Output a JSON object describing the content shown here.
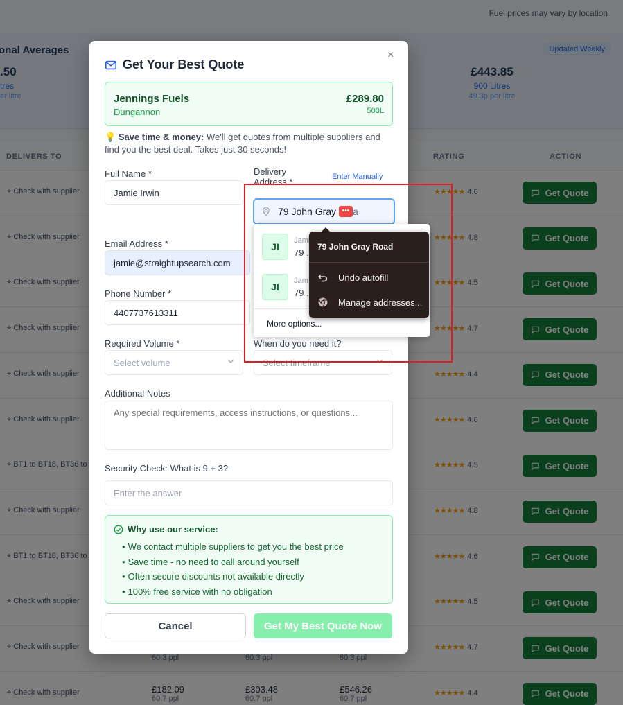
{
  "background": {
    "top_note": "Fuel prices may vary by location",
    "averages_title": "onal Averages",
    "updated_badge": "Updated Weekly",
    "left_price": ".50",
    "left_litres": "tres",
    "left_per": "er litre",
    "right_price": "£443.85",
    "right_litres": "900 Litres",
    "right_per": "49.3p per litre",
    "headers": {
      "delivers_to": "DELIVERS TO",
      "rating": "RATING",
      "action": "ACTION"
    },
    "rows": [
      {
        "delivers": "Check with supplier",
        "rating": "4.6"
      },
      {
        "delivers": "Check with supplier",
        "rating": "4.8"
      },
      {
        "delivers": "Check with supplier",
        "rating": "4.5"
      },
      {
        "delivers": "Check with supplier",
        "rating": "4.7"
      },
      {
        "delivers": "Check with supplier",
        "rating": "4.4"
      },
      {
        "delivers": "Check with supplier",
        "rating": "4.6"
      },
      {
        "delivers": "BT1 to BT18, BT36 to",
        "rating": "4.5"
      },
      {
        "delivers": "Check with supplier",
        "rating": "4.8"
      },
      {
        "delivers": "BT1 to BT18, BT36 to",
        "rating": "4.6"
      },
      {
        "delivers": "Check with supplier",
        "rating": "4.5"
      },
      {
        "delivers": "Check with supplier",
        "rating": "4.7"
      },
      {
        "delivers": "Check with supplier",
        "rating": "4.4"
      }
    ],
    "last_row_prices": [
      {
        "price": "£182.09",
        "ppl": "60.7 ppl"
      },
      {
        "price": "£303.48",
        "ppl": "60.7 ppl"
      },
      {
        "price": "£546.26",
        "ppl": "60.7 ppl"
      }
    ],
    "prev_row_ppl": [
      "60.3 ppl",
      "60.3 ppl",
      "60.3 ppl"
    ],
    "quote_button_label": "Get Quote",
    "stars": "★★★★★"
  },
  "modal": {
    "title": "Get Your Best Quote",
    "close": "×",
    "supplier": {
      "name": "Jennings Fuels",
      "location": "Dungannon",
      "price": "£289.80",
      "volume": "500L"
    },
    "tip_bold": "Save time & money:",
    "tip_text": " We'll get quotes from multiple suppliers and find you the best deal. Takes just 30 seconds!",
    "full_name": {
      "label": "Full Name *",
      "value": "Jamie  Irwin"
    },
    "address": {
      "label_line1": "Delivery",
      "label_line2": "Address *",
      "enter_manually": "Enter Manually",
      "value": "79 John Gray",
      "tail": "a",
      "pw_icon": "•••"
    },
    "email": {
      "label": "Email Address *",
      "value": "jamie@straightupsearch.com"
    },
    "phone": {
      "label": "Phone Number *",
      "value": "4407737613311"
    },
    "volume": {
      "label": "Required Volume *",
      "placeholder": "Select volume"
    },
    "timeframe": {
      "label": "When do you need it?",
      "placeholder": "Select timeframe"
    },
    "notes": {
      "label": "Additional Notes",
      "placeholder": "Any special requirements, access instructions, or questions..."
    },
    "security": {
      "label": "Security Check: What is 9 + 3?",
      "placeholder": "Enter the answer"
    },
    "why": {
      "title": "Why use our service:",
      "items": [
        "We contact multiple suppliers to get you the best price",
        "Save time - no need to call around yourself",
        "Often secure discounts not available directly",
        "100% free service with no obligation"
      ]
    },
    "cancel": "Cancel",
    "submit": "Get My Best Quote Now"
  },
  "autofill": {
    "items": [
      {
        "initials": "JI",
        "name": "Jami",
        "address": "79 ."
      },
      {
        "initials": "JI",
        "name": "Jam",
        "address": "79 ."
      }
    ],
    "more_options": "More options..."
  },
  "context_menu": {
    "title": "79 John Gray Road",
    "undo": "Undo autofill",
    "manage": "Manage addresses..."
  },
  "colors": {
    "accent_green": "#15803d",
    "annotation_red": "#e11d24",
    "focus_blue": "#60a5fa"
  }
}
